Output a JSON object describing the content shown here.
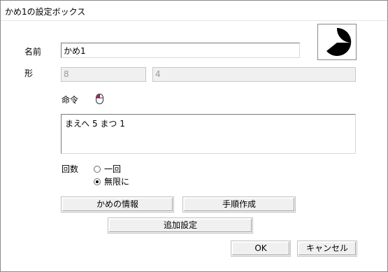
{
  "window": {
    "title": "かめ1の設定ボックス"
  },
  "form": {
    "name_label": "名前",
    "name_value": "かめ1",
    "shape_label": "形",
    "shape_value_1": "8",
    "shape_value_2": "4",
    "command_label": "命令",
    "command_text": "まえへ 5 まつ 1",
    "count_label": "回数",
    "radio_once_label": "一回",
    "radio_infinite_label": "無限に",
    "selected_count_option": "無限に"
  },
  "icons": {
    "turtle_preview": "pacman-turtle-icon",
    "command_mouse": "mouse-icon"
  },
  "buttons": {
    "turtle_info": "かめの情報",
    "make_procedure": "手順作成",
    "extra_settings": "追加設定",
    "ok": "OK",
    "cancel": "キャンセル"
  },
  "colors": {
    "mouse_accent": "#c01070"
  }
}
